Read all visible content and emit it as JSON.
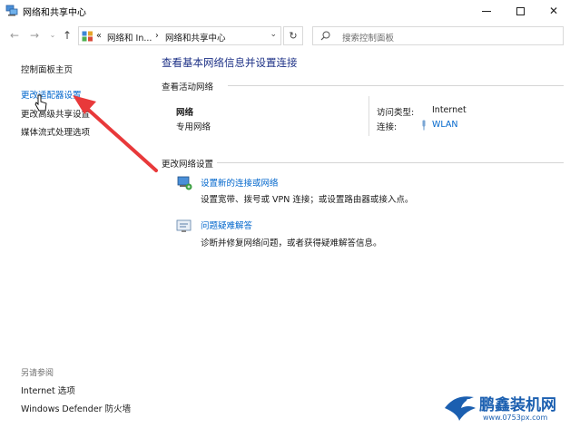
{
  "window": {
    "title": "网络和共享中心",
    "icons": {
      "app": "network-center-icon",
      "minimize": "minimize-icon",
      "maximize": "maximize-icon",
      "close": "close-icon"
    }
  },
  "address_bar": {
    "overflow": "«",
    "crumb1": "网络和 In...",
    "sep": "›",
    "crumb2": "网络和共享中心",
    "search_placeholder": "搜索控制面板"
  },
  "left_nav": {
    "items": [
      "控制面板主页",
      "更改适配器设置",
      "更改高级共享设置",
      "媒体流式处理选项"
    ],
    "see_also_label": "另请参阅",
    "see_also_items": [
      "Internet 选项",
      "Windows Defender 防火墙"
    ]
  },
  "main": {
    "heading": "查看基本网络信息并设置连接",
    "active_networks_label": "查看活动网络",
    "network": {
      "name": "网络",
      "type": "专用网络",
      "access_type_label": "访问类型:",
      "access_type_value": "Internet",
      "connections_label": "连接:",
      "connection_value": "WLAN"
    },
    "change_settings_label": "更改网络设置",
    "tasks": [
      {
        "link": "设置新的连接或网络",
        "desc": "设置宽带、拨号或 VPN 连接；或设置路由器或接入点。"
      },
      {
        "link": "问题疑难解答",
        "desc": "诊断并修复网络问题，或者获得疑难解答信息。"
      }
    ]
  },
  "watermark": {
    "brand": "鹏鑫装机网",
    "url": "www.0753px.com"
  },
  "colors": {
    "link": "#0066cc",
    "heading": "#1e3287",
    "arrow": "#e8393a"
  }
}
